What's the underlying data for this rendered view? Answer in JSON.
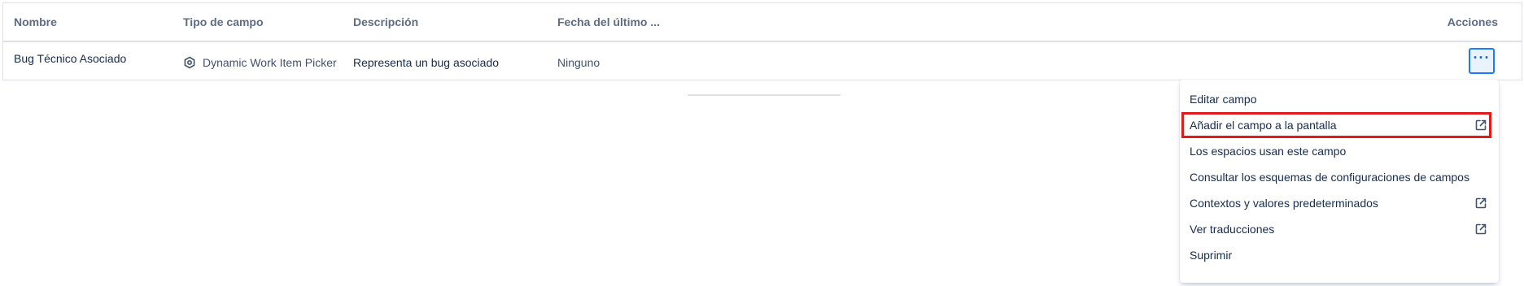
{
  "table": {
    "headers": {
      "name": "Nombre",
      "type": "Tipo de campo",
      "description": "Descripción",
      "last_date": "Fecha del último ...",
      "actions": "Acciones"
    },
    "rows": [
      {
        "name": "Bug Técnico Asociado",
        "type": "Dynamic Work Item Picker",
        "type_icon": "hexagon-settings-icon",
        "description": "Representa un bug asociado",
        "last_date": "Ninguno",
        "actions_label": "···"
      }
    ]
  },
  "menu": {
    "items": [
      {
        "label": "Editar campo",
        "external": false
      },
      {
        "label": "Añadir el campo a la pantalla",
        "external": true,
        "highlighted": true
      },
      {
        "label": "Los espacios usan este campo",
        "external": false
      },
      {
        "label": "Consultar los esquemas de configuraciones de campos",
        "external": false
      },
      {
        "label": "Contextos y valores predeterminados",
        "external": true
      },
      {
        "label": "Ver traducciones",
        "external": true
      },
      {
        "label": "Suprimir",
        "external": false
      }
    ]
  },
  "colors": {
    "accent": "#0c66e4",
    "highlight_outline": "#e01b1b",
    "header_text": "#5e6c84"
  }
}
